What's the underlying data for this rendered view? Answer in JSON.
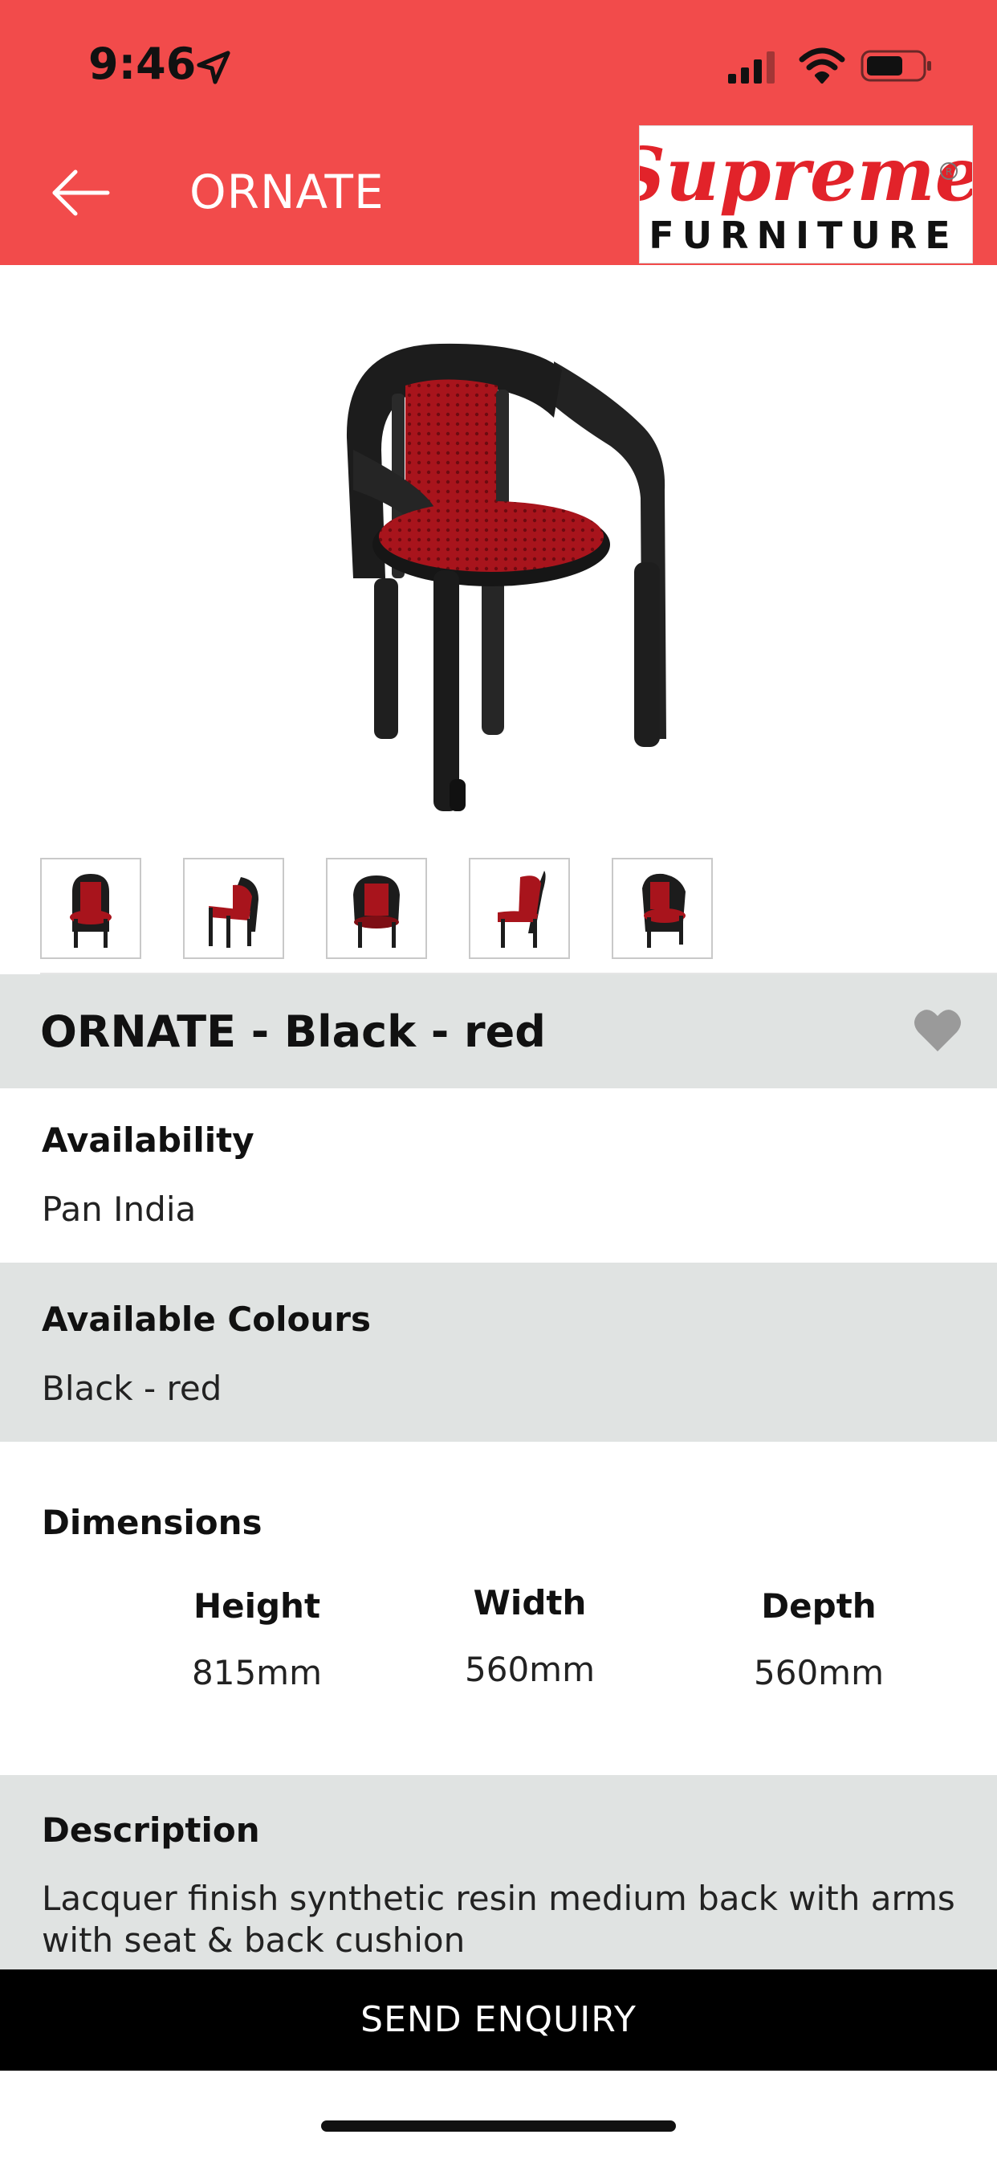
{
  "status_bar": {
    "time": "9:46"
  },
  "app_bar": {
    "title": "ORNATE",
    "brand": {
      "name": "Supreme",
      "tagline": "FURNITURE"
    }
  },
  "gallery": {
    "thumbnail_count": 5
  },
  "product": {
    "title": "ORNATE - Black - red"
  },
  "availability": {
    "heading": "Availability",
    "value": "Pan India"
  },
  "colours": {
    "heading": "Available Colours",
    "value": "Black - red"
  },
  "dimensions": {
    "heading": "Dimensions",
    "items": [
      {
        "label": "Height",
        "value": "815mm"
      },
      {
        "label": "Width",
        "value": "560mm"
      },
      {
        "label": "Depth",
        "value": "560mm"
      }
    ]
  },
  "description": {
    "heading": "Description",
    "text": "Lacquer finish synthetic resin medium back with arms with seat & back cushion"
  },
  "actions": {
    "send_enquiry": "SEND ENQUIRY"
  },
  "colors": {
    "header_red": "#f24b4b",
    "section_gray": "#e0e3e2",
    "button_black": "#000000",
    "heart_gray": "#9a9a9a"
  },
  "icons": {
    "back": "arrow-left-icon",
    "favorite": "heart-icon",
    "location": "location-arrow-icon",
    "signal": "cellular-signal-icon",
    "wifi": "wifi-icon",
    "battery": "battery-icon"
  }
}
